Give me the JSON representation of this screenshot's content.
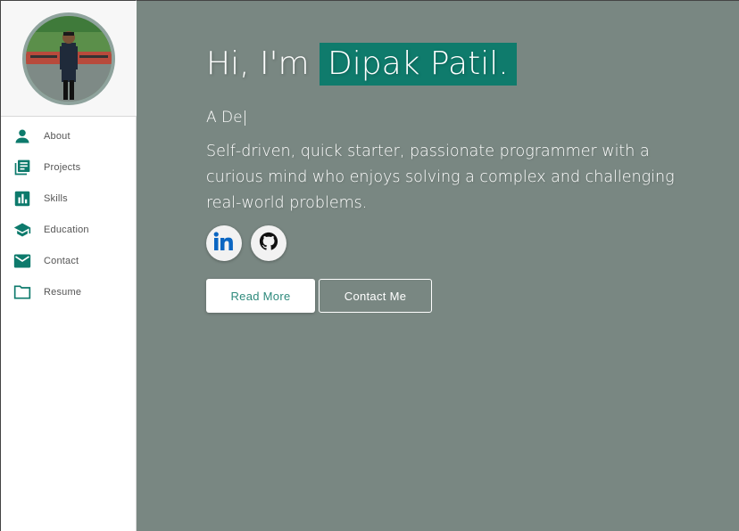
{
  "sidebar": {
    "items": [
      {
        "label": "About",
        "icon": "person-icon"
      },
      {
        "label": "Projects",
        "icon": "library-books-icon"
      },
      {
        "label": "Skills",
        "icon": "bar-chart-icon"
      },
      {
        "label": "Education",
        "icon": "school-icon"
      },
      {
        "label": "Contact",
        "icon": "mail-icon"
      },
      {
        "label": "Resume",
        "icon": "folder-icon"
      }
    ]
  },
  "hero": {
    "greeting_prefix": "Hi, I'm",
    "name": "Dipak Patil.",
    "typed_text": "A De|",
    "bio": "Self-driven, quick starter, passionate programmer with a curious mind who enjoys solving a complex and challenging real-world problems.",
    "read_more_label": "Read More",
    "contact_label": "Contact Me"
  },
  "socials": [
    {
      "name": "linkedin-icon"
    },
    {
      "name": "github-icon"
    }
  ],
  "colors": {
    "accent": "#0f7b6c",
    "main_bg": "#798782",
    "icon_teal": "#0d7a6c"
  }
}
